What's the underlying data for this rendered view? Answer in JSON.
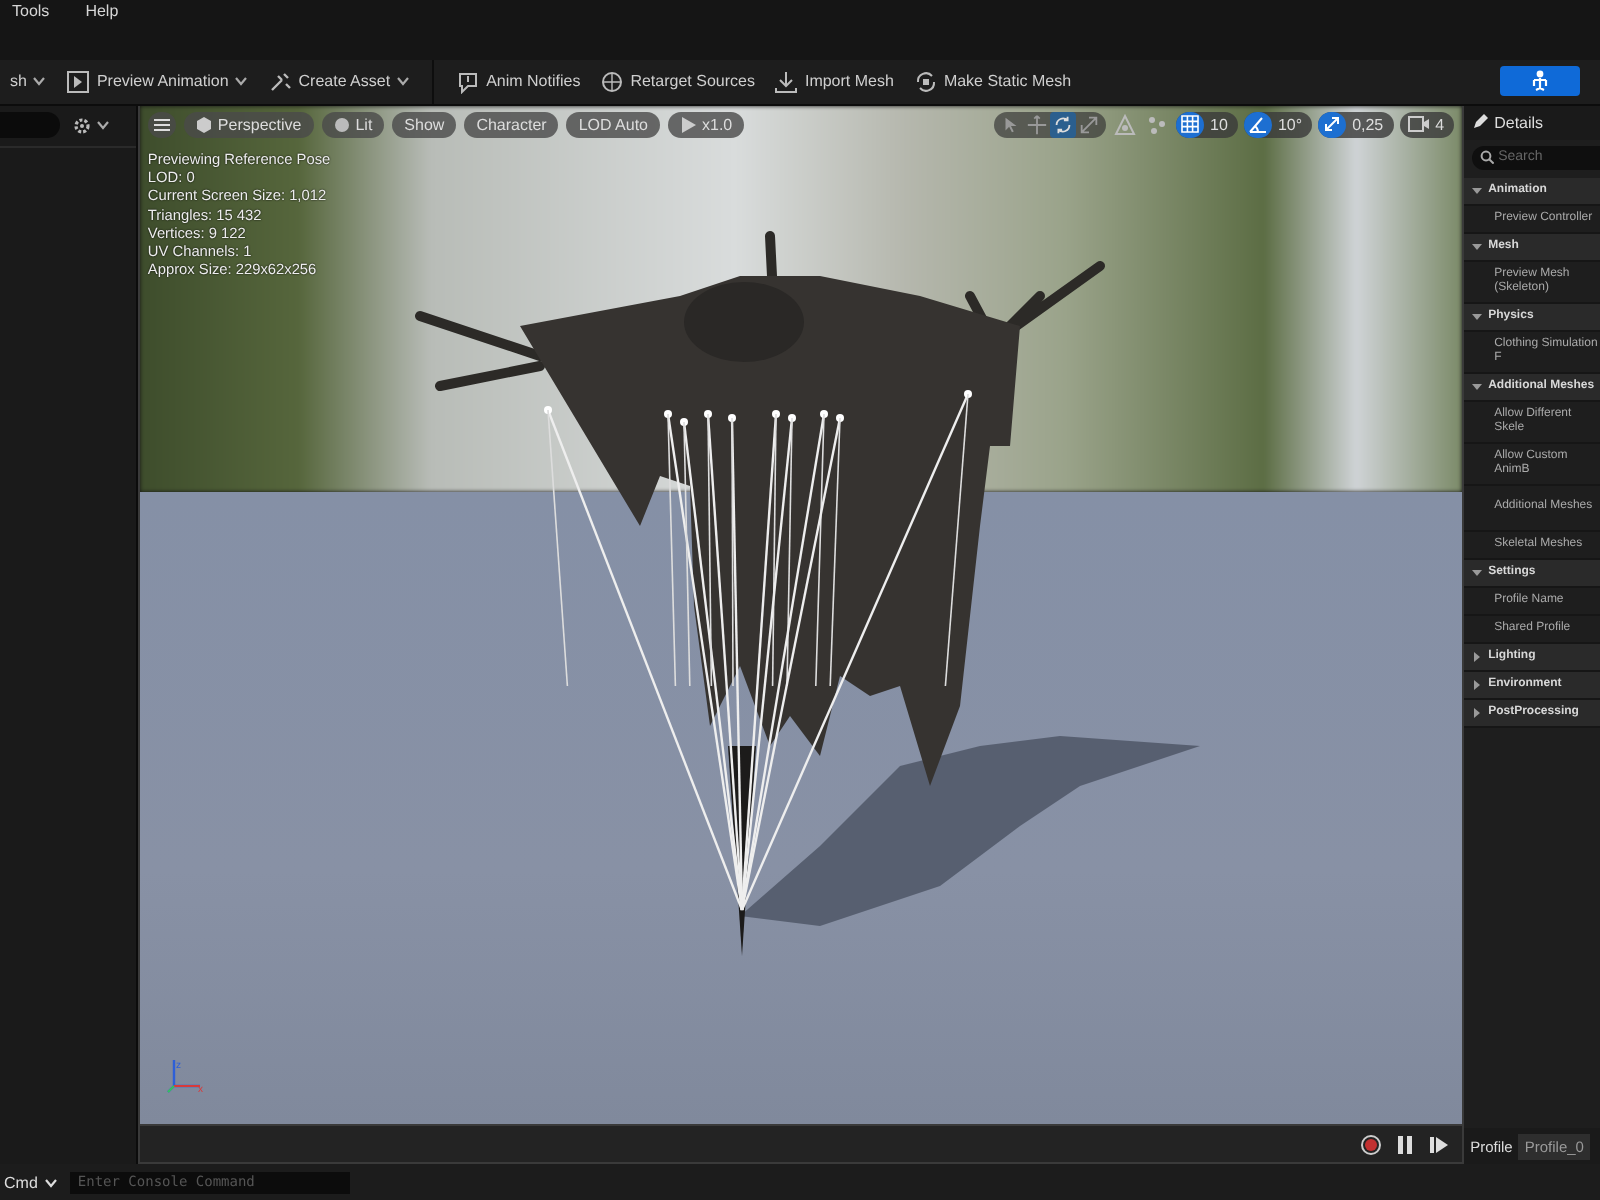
{
  "menu": [
    {
      "label": "Tools"
    },
    {
      "label": "Help"
    }
  ],
  "toolbar": {
    "items": [
      {
        "label": "sh",
        "dropdown": true
      },
      {
        "label": "Preview Animation",
        "dropdown": true
      },
      {
        "label": "Create Asset",
        "dropdown": true
      },
      {
        "label": "Anim Notifies",
        "dropdown": false
      },
      {
        "label": "Retarget Sources",
        "dropdown": false
      },
      {
        "label": "Import Mesh",
        "dropdown": false
      },
      {
        "label": "Make Static Mesh",
        "dropdown": false
      }
    ]
  },
  "viewport": {
    "view_buttons": [
      {
        "label": "Perspective"
      },
      {
        "label": "Lit"
      },
      {
        "label": "Show"
      },
      {
        "label": "Character"
      },
      {
        "label": "LOD Auto"
      },
      {
        "label": "x1.0"
      }
    ],
    "transform_tools": [
      {
        "selected": false
      },
      {
        "selected": false
      },
      {
        "selected": true
      },
      {
        "selected": false
      }
    ],
    "snaps": [
      {
        "label": "10",
        "on": true
      },
      {
        "label": "10°",
        "on": true
      },
      {
        "label": "0,25",
        "on": true
      }
    ],
    "camera_speed": "4",
    "axis_labels": [
      "z",
      "x"
    ],
    "stats": [
      "Previewing Reference Pose",
      "LOD: 0",
      "Current Screen Size: 1,012",
      "Triangles: 15 432",
      "Vertices: 9 122",
      "UV Channels: 1",
      "Approx Size: 229x62x256"
    ]
  },
  "details": {
    "title": "Details",
    "search_placeholder": "Search",
    "rows": [
      {
        "kind": "category",
        "label": "Animation",
        "expanded": true
      },
      {
        "kind": "property",
        "label": "Preview Controller"
      },
      {
        "kind": "category",
        "label": "Mesh",
        "expanded": true
      },
      {
        "kind": "property",
        "label": "Preview Mesh (Skeleton)"
      },
      {
        "kind": "category",
        "label": "Physics",
        "expanded": true
      },
      {
        "kind": "property",
        "label": "Clothing Simulation F"
      },
      {
        "kind": "category",
        "label": "Additional Meshes",
        "expanded": true
      },
      {
        "kind": "property",
        "label": "Allow Different Skele"
      },
      {
        "kind": "property",
        "label": "Allow Custom AnimB"
      },
      {
        "kind": "property",
        "label": "Additional Meshes"
      },
      {
        "kind": "property",
        "label": "Skeletal Meshes"
      },
      {
        "kind": "category",
        "label": "Settings",
        "expanded": true
      },
      {
        "kind": "property",
        "label": "Profile Name"
      },
      {
        "kind": "property",
        "label": "Shared Profile"
      },
      {
        "kind": "category",
        "label": "Lighting",
        "expanded": false
      },
      {
        "kind": "category",
        "label": "Environment",
        "expanded": false
      },
      {
        "kind": "category",
        "label": "PostProcessing",
        "expanded": false
      }
    ]
  },
  "profile": {
    "label": "Profile",
    "value": "Profile_0"
  },
  "console": {
    "label": "Cmd",
    "placeholder": "Enter Console Command"
  }
}
